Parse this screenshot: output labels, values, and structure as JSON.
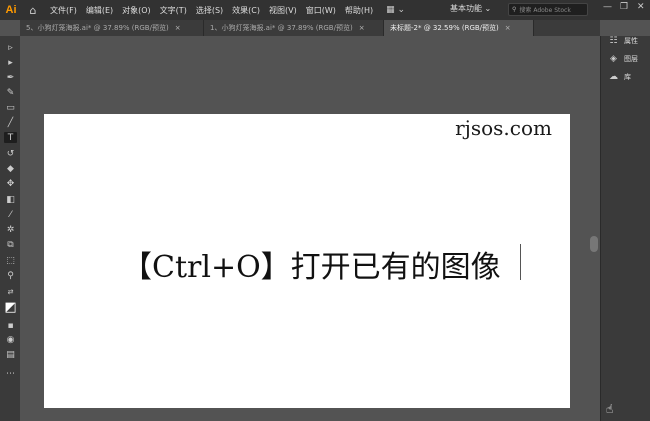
{
  "app": {
    "logo": "Ai",
    "home_icon": "home-icon"
  },
  "menu": [
    "文件(F)",
    "编辑(E)",
    "对象(O)",
    "文字(T)",
    "选择(S)",
    "效果(C)",
    "视图(V)",
    "窗口(W)",
    "帮助(H)"
  ],
  "layout_button": "▦ ⌄",
  "workspace": "基本功能 ⌄",
  "search": {
    "placeholder": "搜索 Adobe Stock"
  },
  "window_controls": [
    "—",
    "❐",
    "✕"
  ],
  "tabs": [
    {
      "label": "5、小狗灯笼海报.ai* @ 37.89% (RGB/预览)",
      "close": "×",
      "active": false
    },
    {
      "label": "1、小狗灯笼海报.ai* @ 37.89% (RGB/预览)",
      "close": "×",
      "active": false
    },
    {
      "label": "未标题-2* @ 32.59% (RGB/预览)",
      "close": "×",
      "active": true
    }
  ],
  "tools": [
    {
      "name": "selection-tool-icon",
      "glyph": "▹"
    },
    {
      "name": "direct-selection-tool-icon",
      "glyph": "▸"
    },
    {
      "name": "pen-tool-icon",
      "glyph": "✒"
    },
    {
      "name": "curvature-tool-icon",
      "glyph": "✎"
    },
    {
      "name": "rectangle-tool-icon",
      "glyph": "▭"
    },
    {
      "name": "paintbrush-tool-icon",
      "glyph": "╱"
    },
    {
      "name": "type-tool-icon",
      "glyph": "T"
    },
    {
      "name": "rotate-tool-icon",
      "glyph": "↺"
    },
    {
      "name": "eraser-tool-icon",
      "glyph": "◆"
    },
    {
      "name": "puppet-warp-tool-icon",
      "glyph": "✥"
    },
    {
      "name": "gradient-tool-icon",
      "glyph": "◧"
    },
    {
      "name": "eyedropper-tool-icon",
      "glyph": "⁄"
    },
    {
      "name": "symbol-sprayer-tool-icon",
      "glyph": "✲"
    },
    {
      "name": "shape-builder-tool-icon",
      "glyph": "⧉"
    },
    {
      "name": "artboard-tool-icon",
      "glyph": "⬚"
    },
    {
      "name": "zoom-tool-icon",
      "glyph": "⚲"
    },
    {
      "name": "swap-colors-icon",
      "glyph": "⇄"
    },
    {
      "name": "fill-stroke-icon",
      "glyph": "◩"
    },
    {
      "name": "color-mode-icon",
      "glyph": "▪"
    },
    {
      "name": "draw-mode-icon",
      "glyph": "◉"
    },
    {
      "name": "screen-mode-icon",
      "glyph": "▤"
    },
    {
      "name": "more-tools-icon",
      "glyph": "⋯"
    }
  ],
  "artboard": {
    "watermark": "rjsos.com",
    "headline": "【Ctrl+O】打开已有的图像"
  },
  "right_panel": [
    {
      "icon": "properties-icon",
      "glyph": "☷",
      "label": "属性"
    },
    {
      "icon": "layers-icon",
      "glyph": "◈",
      "label": "图层"
    },
    {
      "icon": "libraries-icon",
      "glyph": "☁",
      "label": "库"
    }
  ]
}
